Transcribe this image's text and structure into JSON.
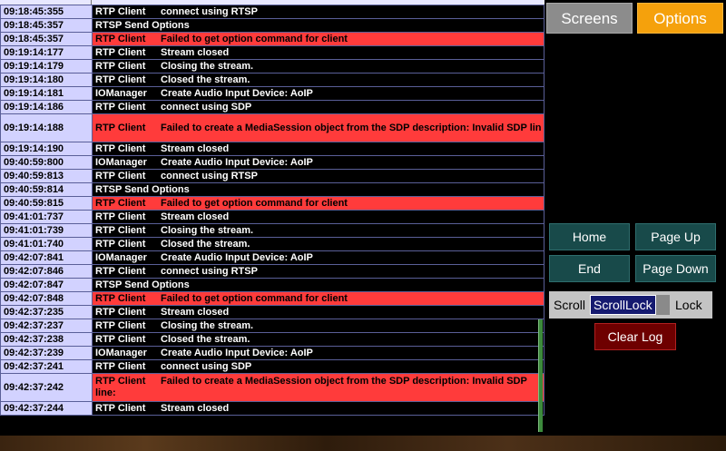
{
  "tabs": {
    "screens": "Screens",
    "options": "Options"
  },
  "nav": {
    "home": "Home",
    "page_up": "Page Up",
    "end": "End",
    "page_down": "Page Down"
  },
  "scroll_toggle": {
    "left": "Scroll",
    "value": "ScrollLock",
    "right": "Lock"
  },
  "clear_log": "Clear Log",
  "colors": {
    "error_row": "#ff3b3b",
    "timestamp_bg": "#d2d2ff",
    "options_tab": "#f5a10c",
    "nav_button": "#184a4a",
    "clear_button": "#6e0000"
  },
  "log_rows": [
    {
      "time": "09:18:45:355",
      "source": "RTP Client",
      "message": "connect using RTSP",
      "error": false
    },
    {
      "time": "09:18:45:357",
      "source": "RTSP Send Options",
      "message": "",
      "error": false
    },
    {
      "time": "09:18:45:357",
      "source": "RTP Client",
      "message": "Failed to get option command for client",
      "error": true
    },
    {
      "time": "09:19:14:177",
      "source": "RTP Client",
      "message": "Stream closed",
      "error": false
    },
    {
      "time": "09:19:14:179",
      "source": "RTP Client",
      "message": "Closing the stream.",
      "error": false
    },
    {
      "time": "09:19:14:180",
      "source": "RTP Client",
      "message": "Closed the stream.",
      "error": false
    },
    {
      "time": "09:19:14:181",
      "source": "IOManager",
      "message": "Create Audio Input Device: AoIP",
      "error": false
    },
    {
      "time": "09:19:14:186",
      "source": "RTP Client",
      "message": "connect using SDP",
      "error": false
    },
    {
      "time": "09:19:14:188",
      "source": "RTP Client",
      "message": "Failed to create a MediaSession object from the SDP description: Invalid SDP lin",
      "error": true,
      "tall": true
    },
    {
      "time": "09:19:14:190",
      "source": "RTP Client",
      "message": "Stream closed",
      "error": false
    },
    {
      "time": "09:40:59:800",
      "source": "IOManager",
      "message": "Create Audio Input Device: AoIP",
      "error": false
    },
    {
      "time": "09:40:59:813",
      "source": "RTP Client",
      "message": "connect using RTSP",
      "error": false
    },
    {
      "time": "09:40:59:814",
      "source": "RTSP Send Options",
      "message": "",
      "error": false
    },
    {
      "time": "09:40:59:815",
      "source": "RTP Client",
      "message": "Failed to get option command for client",
      "error": true
    },
    {
      "time": "09:41:01:737",
      "source": "RTP Client",
      "message": "Stream closed",
      "error": false
    },
    {
      "time": "09:41:01:739",
      "source": "RTP Client",
      "message": "Closing the stream.",
      "error": false
    },
    {
      "time": "09:41:01:740",
      "source": "RTP Client",
      "message": "Closed the stream.",
      "error": false
    },
    {
      "time": "09:42:07:841",
      "source": "IOManager",
      "message": "Create Audio Input Device: AoIP",
      "error": false
    },
    {
      "time": "09:42:07:846",
      "source": "RTP Client",
      "message": "connect using RTSP",
      "error": false
    },
    {
      "time": "09:42:07:847",
      "source": "RTSP Send Options",
      "message": "",
      "error": false
    },
    {
      "time": "09:42:07:848",
      "source": "RTP Client",
      "message": "Failed to get option command for client",
      "error": true
    },
    {
      "time": "09:42:37:235",
      "source": "RTP Client",
      "message": "Stream closed",
      "error": false
    },
    {
      "time": "09:42:37:237",
      "source": "RTP Client",
      "message": "Closing the stream.",
      "error": false
    },
    {
      "time": "09:42:37:238",
      "source": "RTP Client",
      "message": "Closed the stream.",
      "error": false
    },
    {
      "time": "09:42:37:239",
      "source": "IOManager",
      "message": "Create Audio Input Device: AoIP",
      "error": false
    },
    {
      "time": "09:42:37:241",
      "source": "RTP Client",
      "message": "connect using SDP",
      "error": false
    },
    {
      "time": "09:42:37:242",
      "source": "RTP Client",
      "message": "Failed to create a MediaSession object from the SDP description: Invalid SDP line:",
      "error": true,
      "tall": true,
      "wrap": true
    },
    {
      "time": "09:42:37:244",
      "source": "RTP Client",
      "message": "Stream closed",
      "error": false
    }
  ]
}
